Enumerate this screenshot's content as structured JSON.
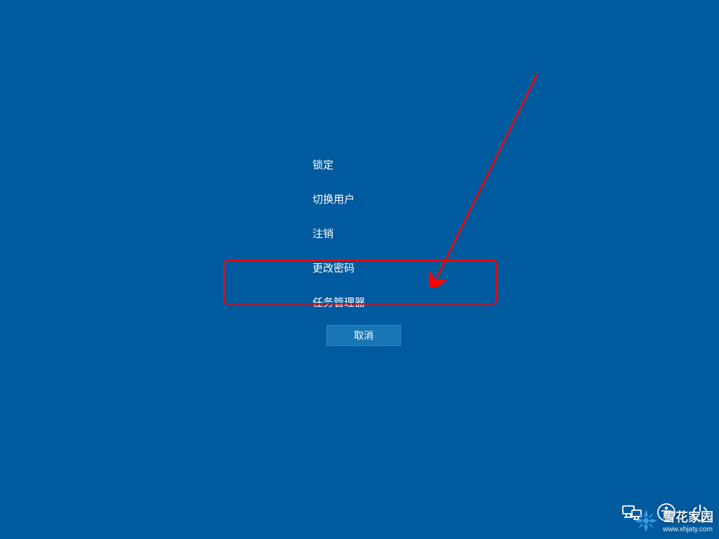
{
  "menu": {
    "items": [
      {
        "label": "锁定"
      },
      {
        "label": "切换用户"
      },
      {
        "label": "注销"
      },
      {
        "label": "更改密码"
      },
      {
        "label": "任务管理器"
      }
    ],
    "cancel_label": "取消",
    "highlighted_index": 4
  },
  "annotation": {
    "arrow_color": "#ff0000",
    "box_color": "#ff0000"
  },
  "watermark": {
    "title": "雪花家园",
    "url": "www.xhjaty.com"
  },
  "colors": {
    "background": "#005a9e",
    "button_bg": "#1976b5",
    "text": "#ffffff"
  }
}
